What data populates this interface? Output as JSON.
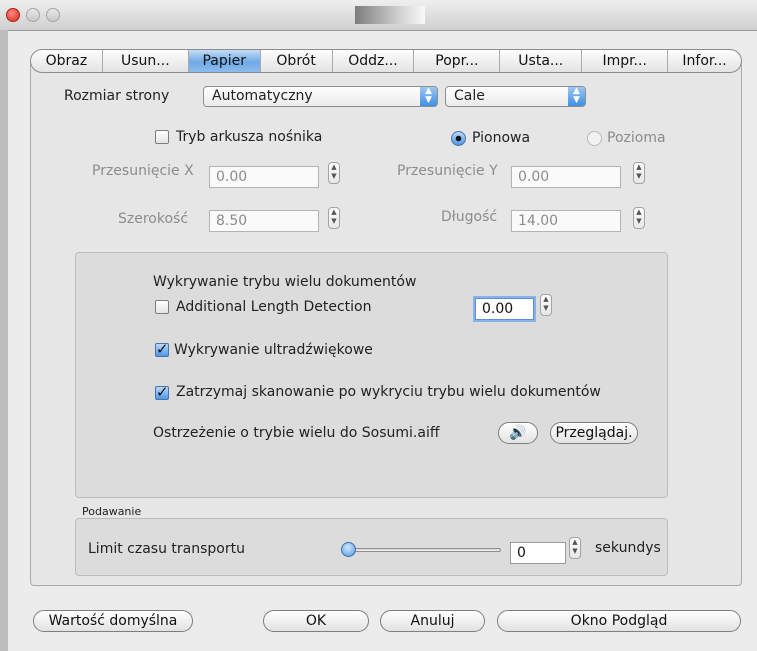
{
  "tabs": [
    {
      "label": "Obraz"
    },
    {
      "label": "Usun..."
    },
    {
      "label": "Papier"
    },
    {
      "label": "Obrót"
    },
    {
      "label": "Oddz..."
    },
    {
      "label": "Popr..."
    },
    {
      "label": "Usta..."
    },
    {
      "label": "Impr..."
    },
    {
      "label": "Infor..."
    }
  ],
  "selected_tab": "Papier",
  "page_size": {
    "label": "Rozmiar strony",
    "value": "Automatyczny",
    "unit": "Cale"
  },
  "carrier_sheet": {
    "label": "Tryb arkusza nośnika",
    "checked": false
  },
  "orientation": {
    "portrait": "Pionowa",
    "landscape": "Pozioma",
    "selected": "Pionowa"
  },
  "offset_x": {
    "label": "Przesunięcie X",
    "value": "0.00"
  },
  "offset_y": {
    "label": "Przesunięcie Y",
    "value": "0.00"
  },
  "width": {
    "label": "Szerokość",
    "value": "8.50"
  },
  "length": {
    "label": "Długość",
    "value": "14.00"
  },
  "multifeed": {
    "title": "Wykrywanie trybu wielu dokumentów",
    "additional_length": {
      "label": "Additional Length Detection",
      "checked": false,
      "value": "0.00"
    },
    "ultrasonic": {
      "label": "Wykrywanie ultradźwiękowe",
      "checked": true
    },
    "stop_scan": {
      "label": "Zatrzymaj skanowanie po wykryciu trybu wielu dokumentów",
      "checked": true
    },
    "warning": {
      "label": "Ostrzeżenie o trybie wielu do Sosumi.aiff",
      "sound_icon": "speaker-icon",
      "browse": "Przeglądaj."
    }
  },
  "feeding": {
    "title": "Podawanie",
    "timeout_label": "Limit czasu transportu",
    "value": "0",
    "slider_fraction": 0,
    "unit": "sekundys"
  },
  "buttons": {
    "default": "Wartość domyślna",
    "ok": "OK",
    "cancel": "Anuluj",
    "preview": "Okno Podgląd"
  },
  "colors": {
    "accent": "#4d96e6",
    "selected_tab": "#6fa9e6"
  }
}
